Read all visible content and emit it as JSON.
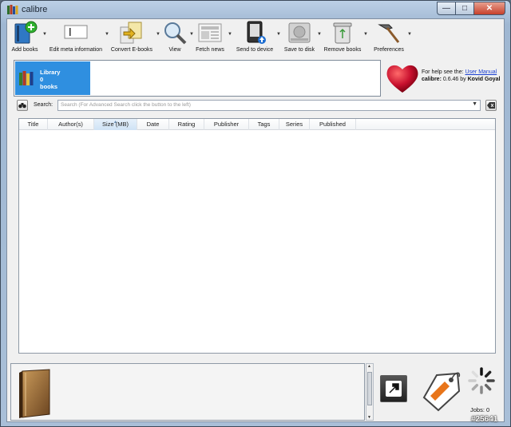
{
  "window": {
    "title": "calibre"
  },
  "toolbar": {
    "items": [
      {
        "label": "Add books",
        "icon": "add-books-icon"
      },
      {
        "label": "Edit meta information",
        "icon": "edit-metadata-icon"
      },
      {
        "label": "Convert E-books",
        "icon": "convert-icon"
      },
      {
        "label": "View",
        "icon": "magnifier-icon"
      },
      {
        "label": "Fetch news",
        "icon": "news-icon"
      },
      {
        "label": "Send to device",
        "icon": "device-icon"
      },
      {
        "label": "Save to disk",
        "icon": "disk-icon"
      },
      {
        "label": "Remove books",
        "icon": "trash-icon"
      },
      {
        "label": "Preferences",
        "icon": "hammer-icon"
      }
    ]
  },
  "library": {
    "name": "Library",
    "count": "0",
    "unit": "books"
  },
  "help": {
    "prefix": "For help see the:",
    "link": "User Manual",
    "app": "calibre:",
    "version_text": "0.6.46 by",
    "author": "Kovid Goyal"
  },
  "search": {
    "label": "Search:",
    "placeholder": "Search (For Advanced Search click the button to the left)"
  },
  "table": {
    "columns": [
      "Title",
      "Author(s)",
      "Size (MB)",
      "Date",
      "Rating",
      "Publisher",
      "Tags",
      "Series",
      "Published"
    ],
    "sorted_column": "Size (MB)",
    "sort_indicator": "▲",
    "rows": []
  },
  "status": {
    "jobs": "Jobs: 0"
  },
  "watermark": "#25641",
  "colors": {
    "accent": "#2f8fe0",
    "heart": "#c8102e",
    "link": "#1a3fd1"
  }
}
